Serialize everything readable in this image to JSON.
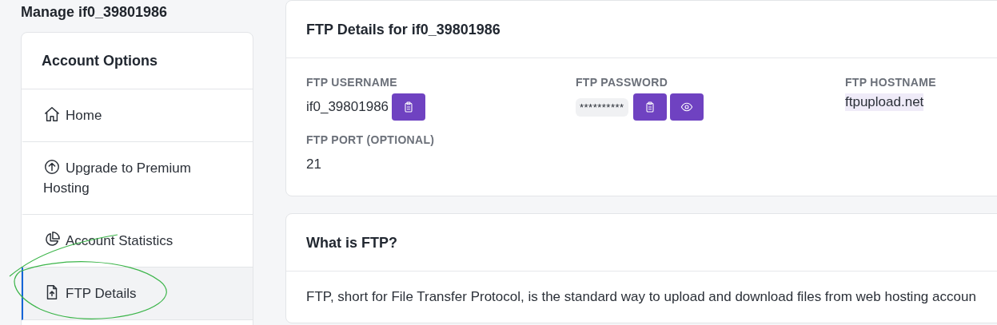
{
  "page_title": "Manage if0_39801986",
  "sidebar": {
    "title": "Account Options",
    "items": [
      {
        "label": "Home",
        "kind": "home",
        "selected": false
      },
      {
        "label": "Upgrade to Premium Hosting",
        "kind": "upgrade",
        "selected": false
      },
      {
        "label": "Account Statistics",
        "kind": "stats",
        "selected": false
      },
      {
        "label": "FTP Details",
        "kind": "ftp",
        "selected": true
      }
    ]
  },
  "ftp_card": {
    "title": "FTP Details for if0_39801986",
    "fields": [
      {
        "label": "FTP USERNAME",
        "kind": "copyable",
        "value": "if0_39801986"
      },
      {
        "label": "FTP PASSWORD",
        "kind": "secret",
        "value": "**********"
      },
      {
        "label": "FTP HOSTNAME",
        "kind": "highlighted",
        "value": "ftpupload.net"
      },
      {
        "label": "FTP PORT (OPTIONAL)",
        "kind": "plain",
        "value": "21"
      }
    ]
  },
  "info_card": {
    "title": "What is FTP?",
    "text": "FTP, short for File Transfer Protocol, is the standard way to upload and download files from web hosting accoun"
  },
  "annotation": {
    "kind": "freehand-circle"
  }
}
